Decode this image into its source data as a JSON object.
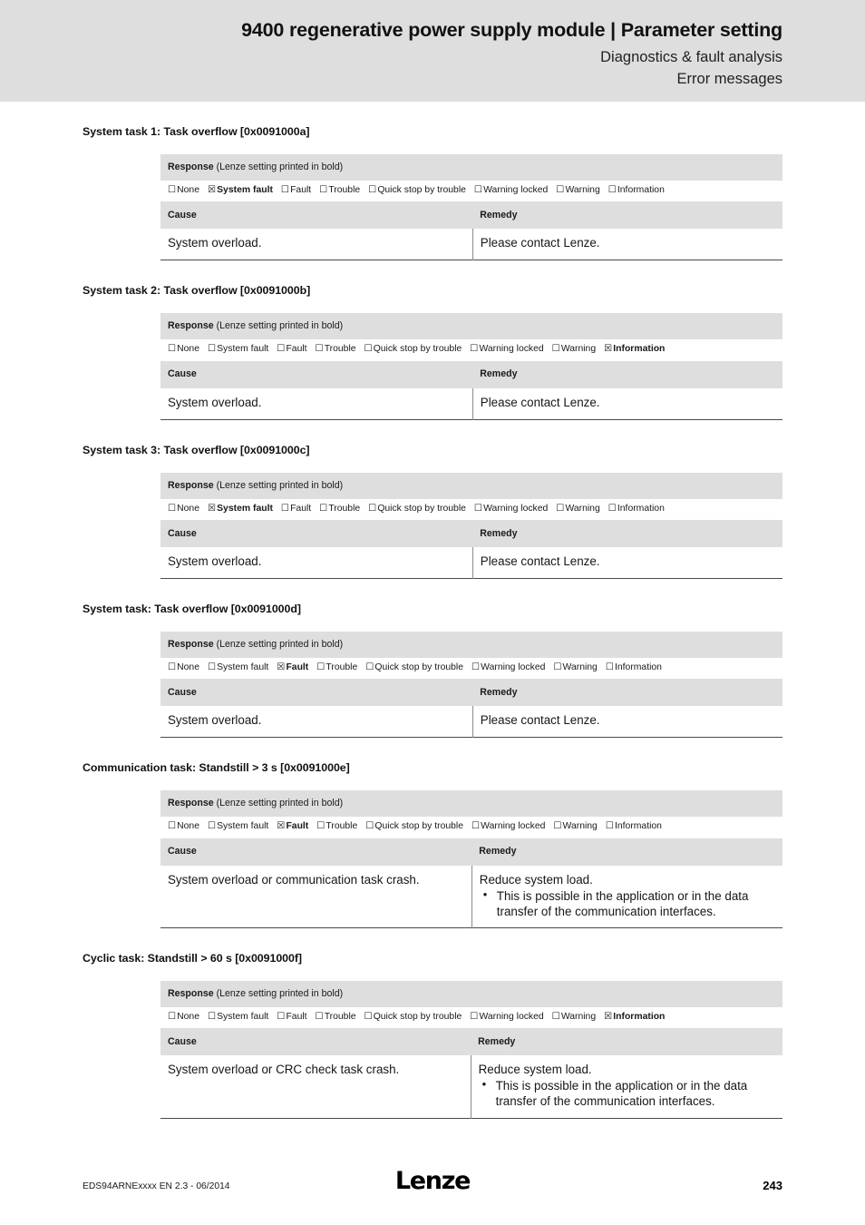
{
  "header": {
    "doc_title": "9400 regenerative power supply module | Parameter setting",
    "subtitle_1": "Diagnostics & fault analysis",
    "subtitle_2": "Error messages"
  },
  "table_labels": {
    "response_label": "Response",
    "response_note": " (Lenze setting printed in bold)",
    "cause_header": "Cause",
    "remedy_header": "Remedy",
    "checkbox_unchecked": "☐",
    "checkbox_checked": "☒"
  },
  "response_options": [
    "None",
    "System fault",
    "Fault",
    "Trouble",
    "Quick stop by trouble",
    "Warning locked",
    "Warning",
    "Information"
  ],
  "sections": [
    {
      "heading": "System task 1: Task overflow [0x0091000a]",
      "selected_response": "System fault",
      "cause": "System overload.",
      "remedy_lead": "Please contact Lenze.",
      "remedy_bullets": []
    },
    {
      "heading": "System task 2: Task overflow [0x0091000b]",
      "selected_response": "Information",
      "cause": "System overload.",
      "remedy_lead": "Please contact Lenze.",
      "remedy_bullets": []
    },
    {
      "heading": "System task 3: Task overflow [0x0091000c]",
      "selected_response": "System fault",
      "cause": "System overload.",
      "remedy_lead": "Please contact Lenze.",
      "remedy_bullets": []
    },
    {
      "heading": "System task: Task overflow [0x0091000d]",
      "selected_response": "Fault",
      "cause": "System overload.",
      "remedy_lead": "Please contact Lenze.",
      "remedy_bullets": []
    },
    {
      "heading": "Communication task: Standstill > 3 s [0x0091000e]",
      "selected_response": "Fault",
      "cause": "System overload or communication task crash.",
      "remedy_lead": "Reduce system load.",
      "remedy_bullets": [
        "This is possible in the application or in the data transfer of the communication interfaces."
      ]
    },
    {
      "heading": "Cyclic task: Standstill > 60 s [0x0091000f]",
      "selected_response": "Information",
      "cause": "System overload or CRC check task crash.",
      "remedy_lead": "Reduce system load.",
      "remedy_bullets": [
        "This is possible in the application or in the data transfer of the communication interfaces."
      ]
    }
  ],
  "footer": {
    "document_id": "EDS94ARNExxxx EN 2.3 - 06/2014",
    "logo_text": "Lenze",
    "page_number": "243"
  }
}
